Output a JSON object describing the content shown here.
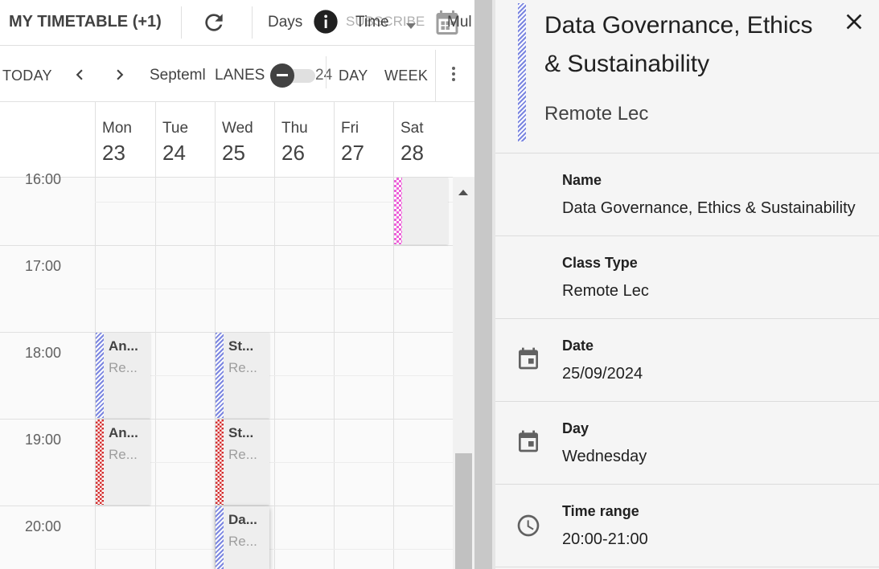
{
  "toolbar": {
    "title": "MY TIMETABLE (+1)",
    "days_label": "Days",
    "subscribe_label": "SUBSCRIBE",
    "time_label": "Time",
    "multi_label": "Mul"
  },
  "nav": {
    "today_label": "TODAY",
    "month_label": "Septeml",
    "lanes_label": "LANES",
    "year_fragment": "24",
    "day_label": "DAY",
    "week_label": "WEEK"
  },
  "days": [
    {
      "name": "Mon",
      "num": "23"
    },
    {
      "name": "Tue",
      "num": "24"
    },
    {
      "name": "Wed",
      "num": "25"
    },
    {
      "name": "Thu",
      "num": "26"
    },
    {
      "name": "Fri",
      "num": "27"
    },
    {
      "name": "Sat",
      "num": "28"
    }
  ],
  "times": [
    "16:00",
    "17:00",
    "18:00",
    "19:00",
    "20:00"
  ],
  "events": [
    {
      "title": "An...",
      "sub": "Re...",
      "day": "Mon",
      "time": "18:00"
    },
    {
      "title": "St...",
      "sub": "Re...",
      "day": "Wed",
      "time": "18:00"
    },
    {
      "title": "An...",
      "sub": "Re...",
      "day": "Mon",
      "time": "19:00"
    },
    {
      "title": "St...",
      "sub": "Re...",
      "day": "Wed",
      "time": "19:00"
    },
    {
      "title": "Da...",
      "sub": "Re...",
      "day": "Wed",
      "time": "20:00"
    }
  ],
  "colors": {
    "blue_stripe": "#7b86e0",
    "red_stripe": "#d32f2f",
    "pink_stripe": "#ec62d8"
  },
  "panel": {
    "title": "Data Governance, Ethics & Sustainability",
    "subtitle": "Remote Lec",
    "fields": [
      {
        "label": "Name",
        "value": "Data Governance, Ethics & Sustainability"
      },
      {
        "label": "Class Type",
        "value": "Remote Lec"
      },
      {
        "label": "Date",
        "value": "25/09/2024",
        "icon": "calendar-icon"
      },
      {
        "label": "Day",
        "value": "Wednesday",
        "icon": "calendar-icon"
      },
      {
        "label": "Time range",
        "value": "20:00-21:00",
        "icon": "clock-icon"
      }
    ]
  }
}
